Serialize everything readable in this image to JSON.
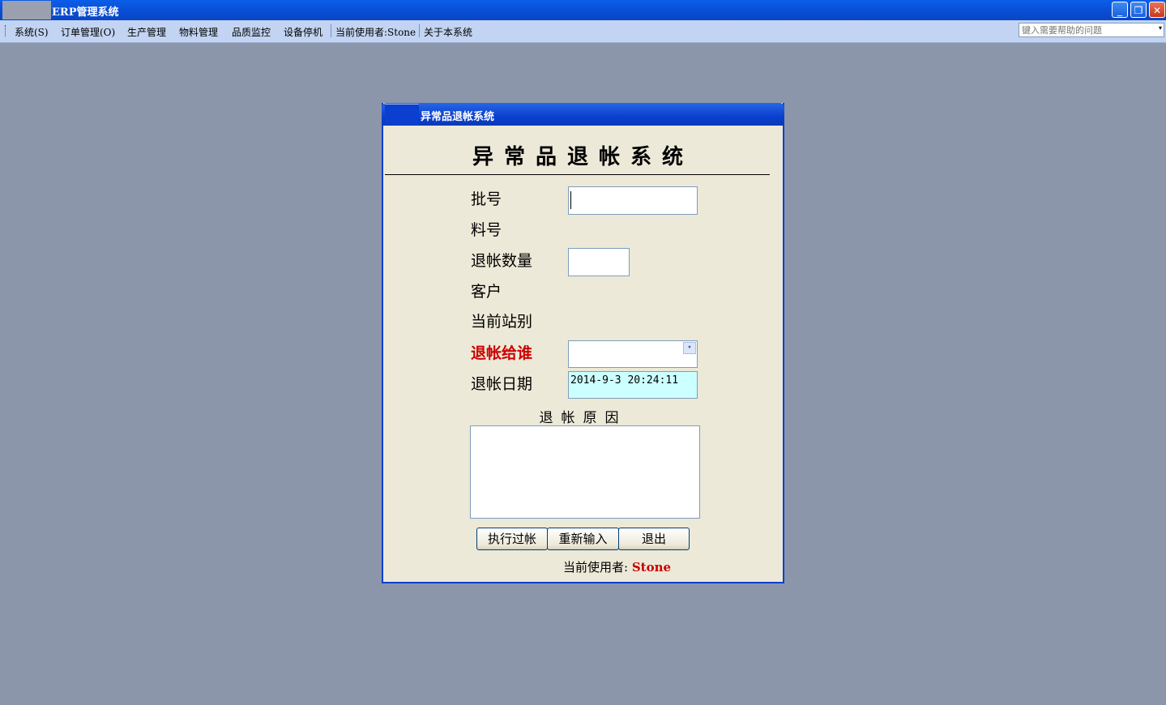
{
  "app": {
    "title": "ERP管理系统"
  },
  "window_controls": {
    "minimize": "_",
    "restore": "❐",
    "close": "✕"
  },
  "menu": {
    "items": [
      "系统(S)",
      "订单管理(O)",
      "生产管理",
      "物料管理",
      "品质监控",
      "设备停机"
    ],
    "current_user_label": "当前使用者:Stone",
    "about": "关于本系统",
    "help_placeholder": "键入需要帮助的问题",
    "help_arrow": "▾"
  },
  "dialog": {
    "window_title": "异常品退帐系统",
    "heading": "异常品退帐系统",
    "fields": {
      "batch_label": "批号",
      "batch_value": "",
      "material_label": "料号",
      "quantity_label": "退帐数量",
      "quantity_value": "",
      "customer_label": "客户",
      "station_label": "当前站别",
      "return_to_label": "退帐给谁",
      "return_to_value": "",
      "date_label": "退帐日期",
      "date_value": "2014-9-3 20:24:11"
    },
    "reason_label": "退帐原因",
    "reason_value": "",
    "combo_arrow": "▾",
    "buttons": {
      "execute": "执行过帐",
      "reset": "重新输入",
      "exit": "退出"
    },
    "current_user_prefix": "当前使用者:",
    "current_user": "Stone"
  }
}
